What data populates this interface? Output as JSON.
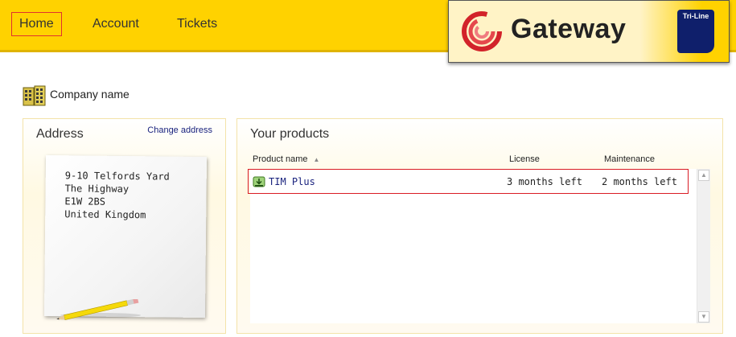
{
  "nav": {
    "items": [
      {
        "label": "Home",
        "active": true
      },
      {
        "label": "Account",
        "active": false
      },
      {
        "label": "Tickets",
        "active": false
      }
    ]
  },
  "logo": {
    "text": "Gateway",
    "badge": "Tri-Line",
    "icon": "gateway-swirl-icon"
  },
  "company": {
    "name": "Company name",
    "icon": "building-icon"
  },
  "address": {
    "title": "Address",
    "change_label": "Change address",
    "lines": [
      "9-10 Telfords Yard",
      "The Highway",
      "E1W 2BS",
      "United Kingdom"
    ]
  },
  "products": {
    "title": "Your products",
    "columns": [
      "Product name",
      "License",
      "Maintenance"
    ],
    "sort_indicator": "▲",
    "rows": [
      {
        "name": "TIM Plus",
        "license": "3 months left",
        "maintenance": "2 months left",
        "icon": "product-download-icon"
      }
    ]
  },
  "colors": {
    "topbar": "#ffd200",
    "highlight_border": "#e0322e",
    "link": "#1a237e",
    "badge": "#0f1f6b"
  }
}
